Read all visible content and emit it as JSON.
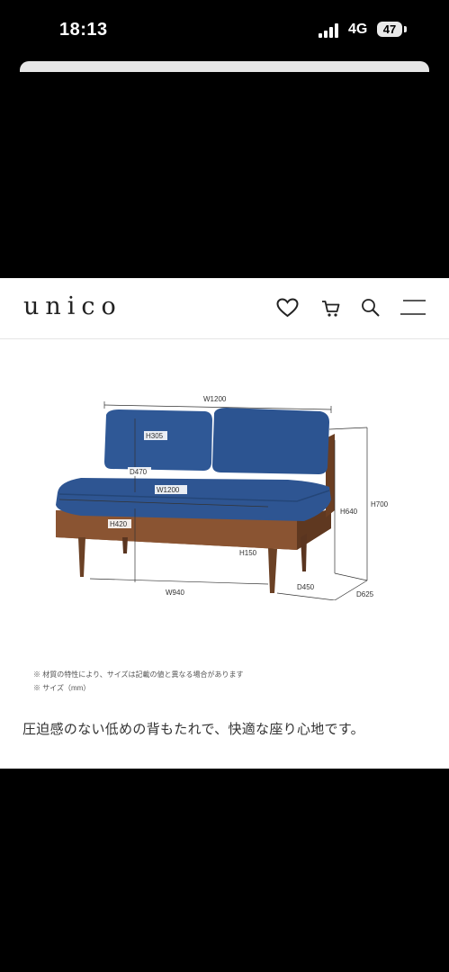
{
  "status_bar": {
    "time": "18:13",
    "network": "4G",
    "battery": "47"
  },
  "header": {
    "logo": "unico",
    "icons": [
      "heart-icon",
      "cart-icon",
      "search-icon",
      "menu-icon"
    ]
  },
  "diagram": {
    "dimensions": {
      "top_width": "W1200",
      "back_height": "H305",
      "seat_depth": "D470",
      "seat_width": "W1200",
      "seat_height": "H420",
      "leg_height": "H150",
      "inner_width": "W940",
      "arm_height": "H640",
      "total_height": "H700",
      "inner_depth": "D450",
      "total_depth": "D625"
    }
  },
  "notes": {
    "line1": "※ 材質の特性により、サイズは記載の値と異なる場合があります",
    "line2": "※ サイズ（mm）"
  },
  "caption": "圧迫感のない低めの背もたれで、快適な座り心地です。",
  "colors": {
    "fabric": "#2e5592",
    "wood": "#7a4a2a",
    "background": "#000000"
  }
}
